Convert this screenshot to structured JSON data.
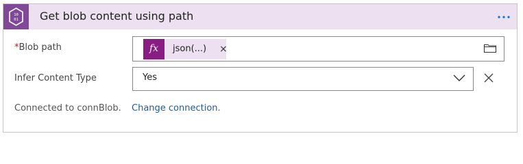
{
  "action": {
    "title": "Get blob content using path",
    "icon": "blob-storage-icon",
    "more_label": "···"
  },
  "fields": {
    "blob_path": {
      "required_mark": "*",
      "label": "Blob path",
      "token_label": "fx",
      "token_text": "json(...)",
      "token_remove": "×",
      "picker_icon": "folder-icon"
    },
    "infer_content_type": {
      "label": "Infer Content Type",
      "value": "Yes",
      "clear_icon": "close-icon"
    }
  },
  "connection": {
    "text": "Connected to connBlob.",
    "change_link": "Change connection."
  },
  "colors": {
    "header_bg": "#ede0f0",
    "icon_bg": "#804998",
    "fx_bg": "#8a1d84",
    "link": "#1a5fa3"
  }
}
